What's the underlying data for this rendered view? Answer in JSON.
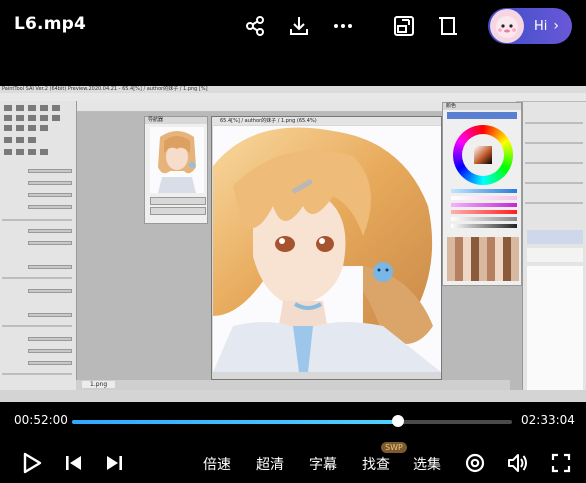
{
  "title": "L6.mp4",
  "top_actions": [
    {
      "name": "share-icon"
    },
    {
      "name": "download-icon"
    },
    {
      "name": "more-icon"
    },
    {
      "name": "cast-icon"
    },
    {
      "name": "rotate-screen-icon"
    }
  ],
  "assistant": {
    "label": "Hi",
    "chevron": "›"
  },
  "player": {
    "current_time": "00:52:00",
    "total_time": "02:33:04",
    "progress": 0.74
  },
  "controls": {
    "speed": "倍速",
    "quality": "超清",
    "subtitles": "字幕",
    "search": "找查",
    "search_badge": "SWP",
    "episodes": "选集"
  },
  "frame": {
    "app_title": "PaintTool SAI Ver.2 (64bit) Preview.2020.04.21 - 65.4[%] / author的妹子 / 1.png [%]",
    "nav_title": "导航器",
    "canvas_title": "65.4[%] / author的妹子 / 1.png (65.4%)",
    "color_title": "颜色",
    "layer_tab": "1.png"
  },
  "colors": {
    "progress": "#2fa8ff",
    "assistant_bg": "#3d4ec8"
  }
}
